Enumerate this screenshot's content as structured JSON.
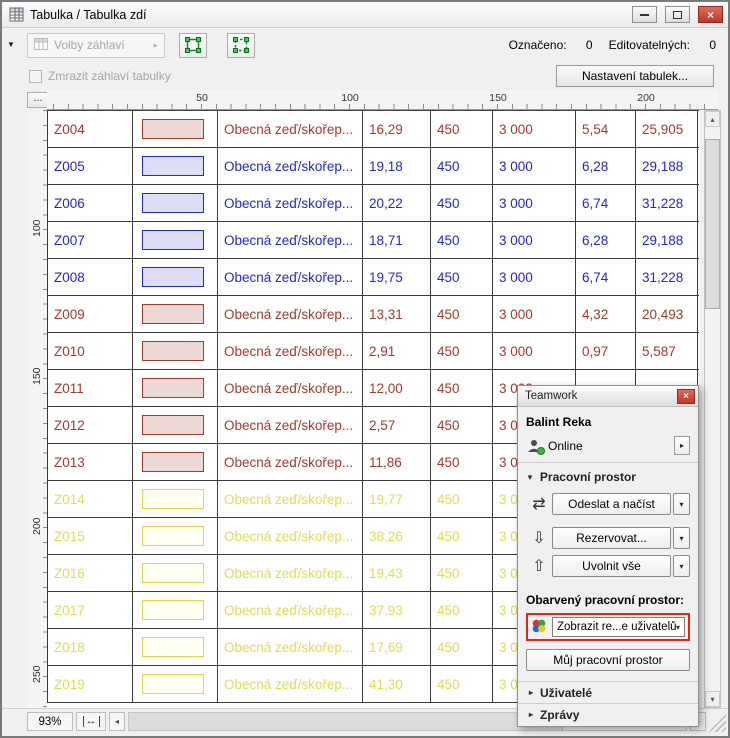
{
  "window": {
    "title": "Tabulka /  Tabulka zdí"
  },
  "toolbar": {
    "header_options_label": "Volby záhlaví",
    "selected_label": "Označeno:",
    "selected_value": "0",
    "editable_label": "Editovatelných:",
    "editable_value": "0",
    "freeze_label": "Zmrazit záhlaví tabulky",
    "table_settings_button": "Nastavení tabulek..."
  },
  "ruler": {
    "corner_button": "...",
    "h_labels": [
      "50",
      "100",
      "150",
      "200"
    ],
    "v_labels": [
      "100",
      "150",
      "200",
      "250"
    ]
  },
  "table": {
    "row_name": "Obecná zeď/skořep...",
    "rows": [
      {
        "id": "Z004",
        "group": "red",
        "v": [
          "16,29",
          "450",
          "3 000",
          "5,54",
          "25,905"
        ]
      },
      {
        "id": "Z005",
        "group": "blue",
        "v": [
          "19,18",
          "450",
          "3 000",
          "6,28",
          "29,188"
        ]
      },
      {
        "id": "Z006",
        "group": "blue",
        "v": [
          "20,22",
          "450",
          "3 000",
          "6,74",
          "31,228"
        ]
      },
      {
        "id": "Z007",
        "group": "blue",
        "v": [
          "18,71",
          "450",
          "3 000",
          "6,28",
          "29,188"
        ]
      },
      {
        "id": "Z008",
        "group": "blue",
        "v": [
          "19,75",
          "450",
          "3 000",
          "6,74",
          "31,228"
        ]
      },
      {
        "id": "Z009",
        "group": "red",
        "v": [
          "13,31",
          "450",
          "3 000",
          "4,32",
          "20,493"
        ]
      },
      {
        "id": "Z010",
        "group": "red",
        "v": [
          "2,91",
          "450",
          "3 000",
          "0,97",
          "5,587"
        ]
      },
      {
        "id": "Z011",
        "group": "red",
        "v": [
          "12,00",
          "450",
          "3 000",
          "",
          ""
        ]
      },
      {
        "id": "Z012",
        "group": "red",
        "v": [
          "2,57",
          "450",
          "3 000",
          "",
          ""
        ]
      },
      {
        "id": "Z013",
        "group": "red",
        "v": [
          "11,86",
          "450",
          "3 000",
          "",
          ""
        ]
      },
      {
        "id": "Z014",
        "group": "yellow",
        "v": [
          "19,77",
          "450",
          "3 000",
          "",
          ""
        ]
      },
      {
        "id": "Z015",
        "group": "yellow",
        "v": [
          "38,26",
          "450",
          "3 000",
          "",
          ""
        ]
      },
      {
        "id": "Z016",
        "group": "yellow",
        "v": [
          "19,43",
          "450",
          "3 000",
          "",
          ""
        ]
      },
      {
        "id": "Z017",
        "group": "yellow",
        "v": [
          "37,93",
          "450",
          "3 000",
          "",
          ""
        ]
      },
      {
        "id": "Z018",
        "group": "yellow",
        "v": [
          "17,69",
          "450",
          "3 000",
          "",
          ""
        ]
      },
      {
        "id": "Z019",
        "group": "yellow",
        "v": [
          "41,30",
          "450",
          "3 000",
          "",
          ""
        ]
      }
    ]
  },
  "statusbar": {
    "zoom": "93%"
  },
  "teamwork": {
    "title": "Teamwork",
    "user": "Balint Reka",
    "status": "Online",
    "workspace_section": "Pracovní prostor",
    "send_receive": "Odeslat a načíst",
    "reserve": "Rezervovat...",
    "release_all": "Uvolnit vše",
    "colored_workspace_label": "Obarvený pracovní prostor:",
    "show_dropdown": "Zobrazit re...e uživatelů",
    "my_workspace": "Můj pracovní prostor",
    "users_section": "Uživatelé",
    "messages_section": "Zprávy"
  },
  "colors": {
    "red_pen": "#A13A31",
    "blue_pen": "#2525D2",
    "yellow_pen": "#DBD84E",
    "annotation_highlight": "#E3231C",
    "online_green": "#3BBA3B"
  },
  "icons": {
    "pane_toggle": "▼",
    "dropdown_right": "▸",
    "dropdown_down": "▾",
    "corner": "...",
    "send_receive": "⇄",
    "reserve": "⇩",
    "release": "⇧",
    "expanded": "▼",
    "collapsed": "▸",
    "close": "×",
    "fit": "↔",
    "left": "◂",
    "right": "▸",
    "up": "▴",
    "down": "▾"
  }
}
